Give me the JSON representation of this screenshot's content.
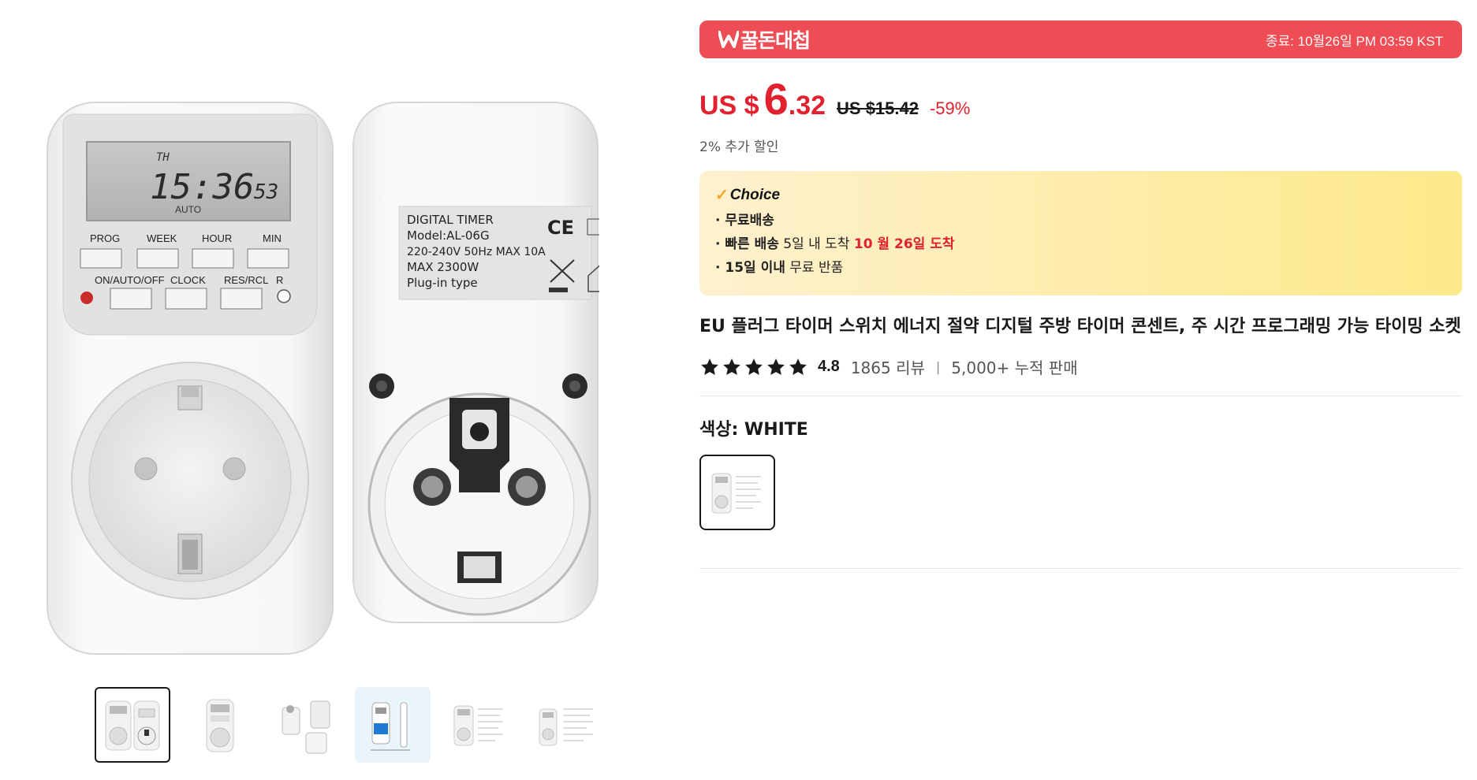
{
  "promo": {
    "brand": "꿀돈대첩",
    "ends": "종료: 10월26일 PM 03:59 KST"
  },
  "price": {
    "currency": "US $",
    "integer": "6",
    "decimal": ".32",
    "original": "US $15.42",
    "discount": "-59%",
    "extra": "2% 추가 할인"
  },
  "choice": {
    "label": "Choice",
    "line1": "· 무료배송",
    "line2_bold": "· 빠른 배송",
    "line2_text": " 5일 내 도착 ",
    "line2_red": "10 월 26일 도착",
    "line3_bold": "· 15일 이내",
    "line3_text": "  무료 반품"
  },
  "title": "EU 플러그 타이머 스위치 에너지 절약 디지털 주방 타이머 콘센트, 주 시간 프로그래밍 가능 타이밍 소켓",
  "rating": {
    "value": "4.8",
    "stars": 5,
    "reviews": "1865 리뷰",
    "sold": "5,000+ 누적 판매"
  },
  "color": {
    "label": "색상: WHITE"
  },
  "product_labels": {
    "lcd_day": "TH",
    "lcd_time": "15:36",
    "lcd_sec": "53",
    "lcd_mode": "AUTO",
    "btn_prog": "PROG",
    "btn_week": "WEEK",
    "btn_hour": "HOUR",
    "btn_min": "MIN",
    "btn_onoff": "ON/AUTO/OFF",
    "btn_clock": "CLOCK",
    "btn_res": "RES/RCL",
    "btn_r": "R",
    "back_l1": "DIGITAL TIMER",
    "back_l2": "Model:AL-06G",
    "back_l3": "220-240V  50Hz  MAX 10A",
    "back_l4": "MAX 2300W",
    "back_l5": "Plug-in type",
    "ce": "CE"
  },
  "colors": {
    "accent_red": "#e3202d",
    "promo_bg": "#ee4d55",
    "choice_bg_start": "#fff1cf",
    "choice_bg_end": "#fde98a"
  }
}
